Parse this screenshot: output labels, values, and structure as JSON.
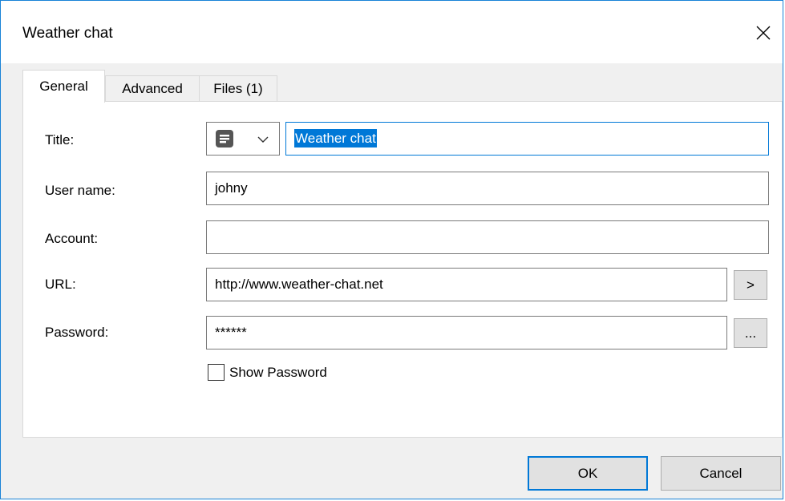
{
  "window": {
    "title": "Weather chat",
    "close_icon": "close-icon"
  },
  "tabs": [
    {
      "label": "General",
      "active": true
    },
    {
      "label": "Advanced",
      "active": false
    },
    {
      "label": "Files (1)",
      "active": false
    }
  ],
  "form": {
    "title_label": "Title:",
    "title_icon": "note-icon",
    "title_value": "Weather chat",
    "username_label": "User name:",
    "username_value": "johny",
    "account_label": "Account:",
    "account_value": "",
    "url_label": "URL:",
    "url_value": "http://www.weather-chat.net",
    "url_open_label": ">",
    "password_label": "Password:",
    "password_value": "******",
    "password_more_label": "...",
    "show_password_label": "Show Password",
    "show_password_checked": false
  },
  "buttons": {
    "ok_label": "OK",
    "cancel_label": "Cancel"
  },
  "colors": {
    "accent": "#0078d7",
    "window_border": "#1883d7"
  }
}
